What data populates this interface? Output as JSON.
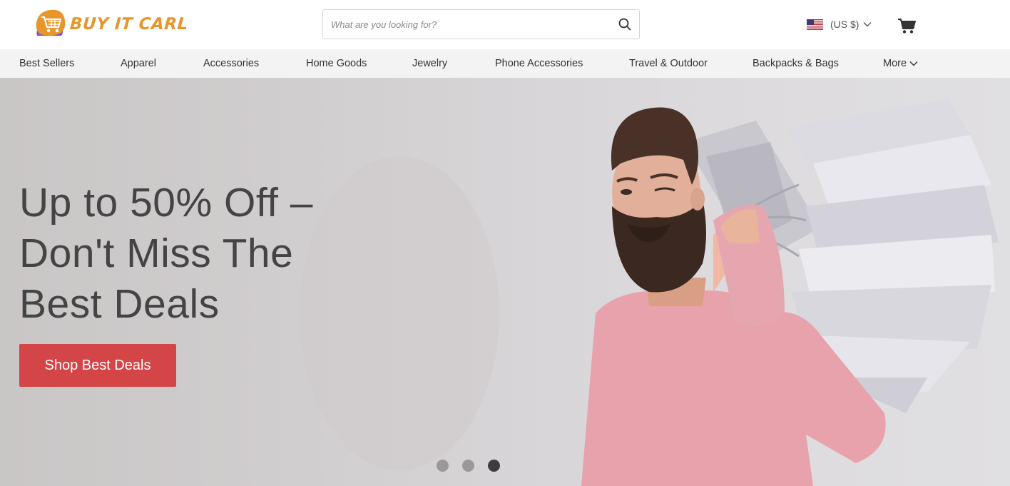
{
  "brand": {
    "name": "BUY IT CARL",
    "color": "#e8962a"
  },
  "search": {
    "placeholder": "What are you looking for?",
    "value": "",
    "icon": "search-icon"
  },
  "currency": {
    "label": "(US $)",
    "flag": "us-flag-icon"
  },
  "cart": {
    "icon": "cart-icon"
  },
  "nav": {
    "items": [
      {
        "label": "Best Sellers"
      },
      {
        "label": "Apparel"
      },
      {
        "label": "Accessories"
      },
      {
        "label": "Home Goods"
      },
      {
        "label": "Jewelry"
      },
      {
        "label": "Phone Accessories"
      },
      {
        "label": "Travel & Outdoor"
      },
      {
        "label": "Backpacks & Bags"
      },
      {
        "label": "More"
      }
    ]
  },
  "hero": {
    "headline_line1": "Up to 50% Off –",
    "headline_line2": "Don't Miss The",
    "headline_line3": "Best Deals",
    "cta_label": "Shop Best Deals",
    "cta_color": "#d44548",
    "slides_total": 3,
    "active_slide": 3
  }
}
